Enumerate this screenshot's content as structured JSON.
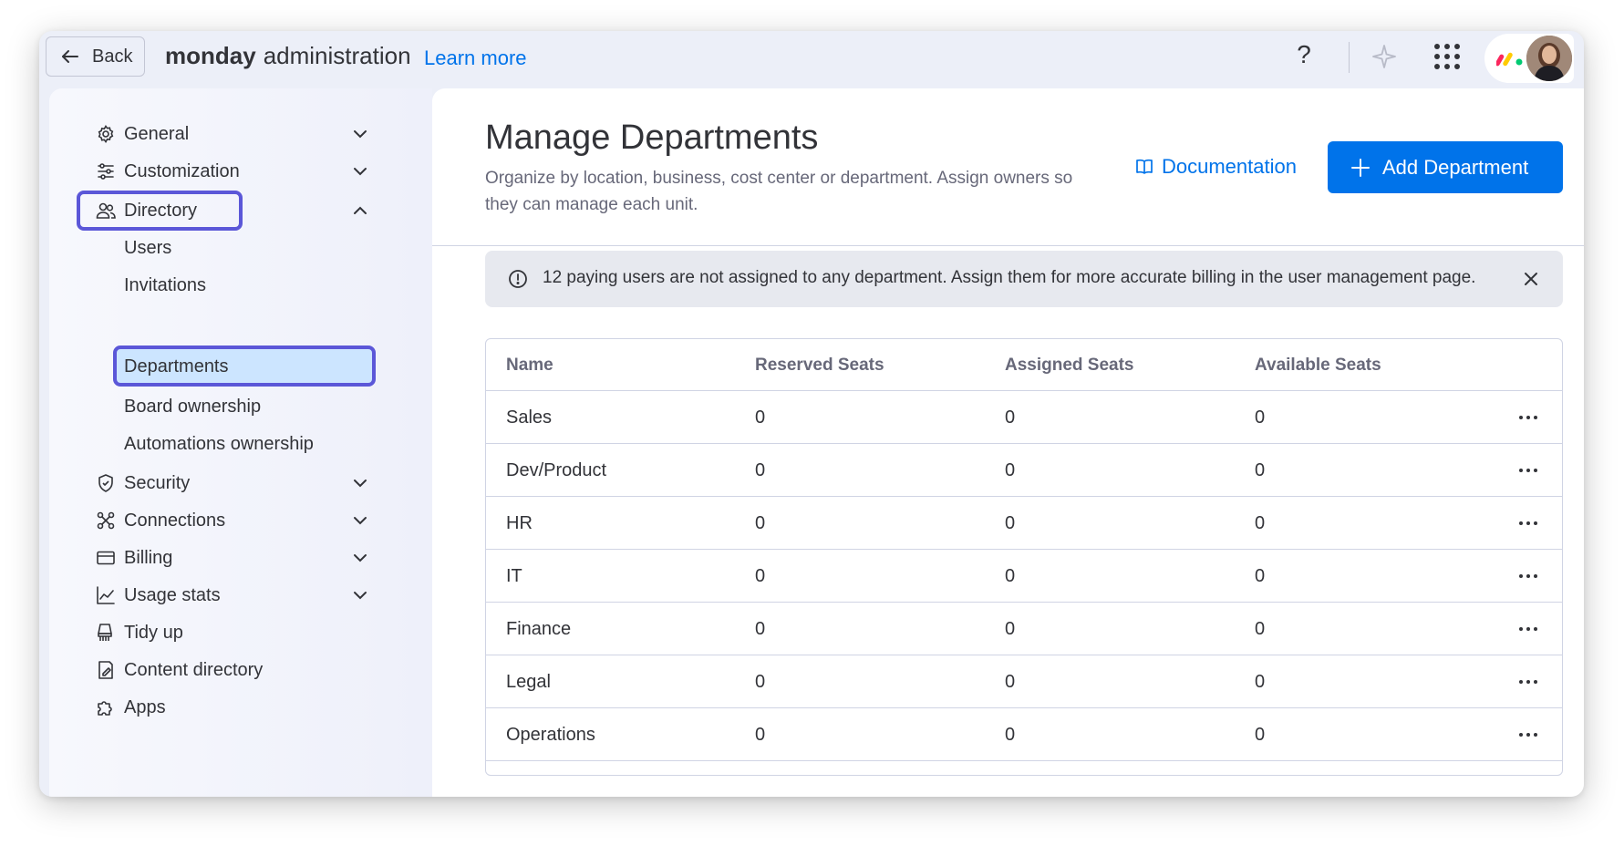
{
  "topbar": {
    "back_label": "Back",
    "brand_bold": "monday",
    "brand_rest": "administration",
    "learn_more": "Learn more",
    "help_symbol": "?"
  },
  "sidebar": {
    "items": [
      {
        "label": "General",
        "icon": "gear-icon",
        "expanded": false
      },
      {
        "label": "Customization",
        "icon": "sliders-icon",
        "expanded": false
      },
      {
        "label": "Directory",
        "icon": "people-icon",
        "expanded": true
      },
      {
        "label": "Users"
      },
      {
        "label": "Invitations"
      },
      {
        "label": "Departments",
        "active": true
      },
      {
        "label": "Board ownership"
      },
      {
        "label": "Automations ownership"
      },
      {
        "label": "Security",
        "icon": "shield-icon",
        "expanded": false
      },
      {
        "label": "Connections",
        "icon": "connections-icon",
        "expanded": false
      },
      {
        "label": "Billing",
        "icon": "billing-icon",
        "expanded": false
      },
      {
        "label": "Usage stats",
        "icon": "chart-icon",
        "expanded": false
      },
      {
        "label": "Tidy up",
        "icon": "broom-icon"
      },
      {
        "label": "Content directory",
        "icon": "content-icon"
      },
      {
        "label": "Apps",
        "icon": "puzzle-icon"
      }
    ]
  },
  "main": {
    "title": "Manage Departments",
    "description": "Organize by location, business, cost center or department. Assign owners so they can manage each unit.",
    "documentation_label": "Documentation",
    "add_button_label": "Add Department",
    "alert_text": "12 paying users are not assigned to any department. Assign them for more accurate billing in the user management page.",
    "table": {
      "columns": [
        "Name",
        "Reserved Seats",
        "Assigned Seats",
        "Available Seats"
      ],
      "rows": [
        [
          "Sales",
          "0",
          "0",
          "0"
        ],
        [
          "Dev/Product",
          "0",
          "0",
          "0"
        ],
        [
          "HR",
          "0",
          "0",
          "0"
        ],
        [
          "IT",
          "0",
          "0",
          "0"
        ],
        [
          "Finance",
          "0",
          "0",
          "0"
        ],
        [
          "Legal",
          "0",
          "0",
          "0"
        ],
        [
          "Operations",
          "0",
          "0",
          "0"
        ]
      ]
    }
  },
  "colors": {
    "accent": "#0073ea",
    "highlight_border": "#5b57d8",
    "active_bg": "#cce5ff"
  }
}
